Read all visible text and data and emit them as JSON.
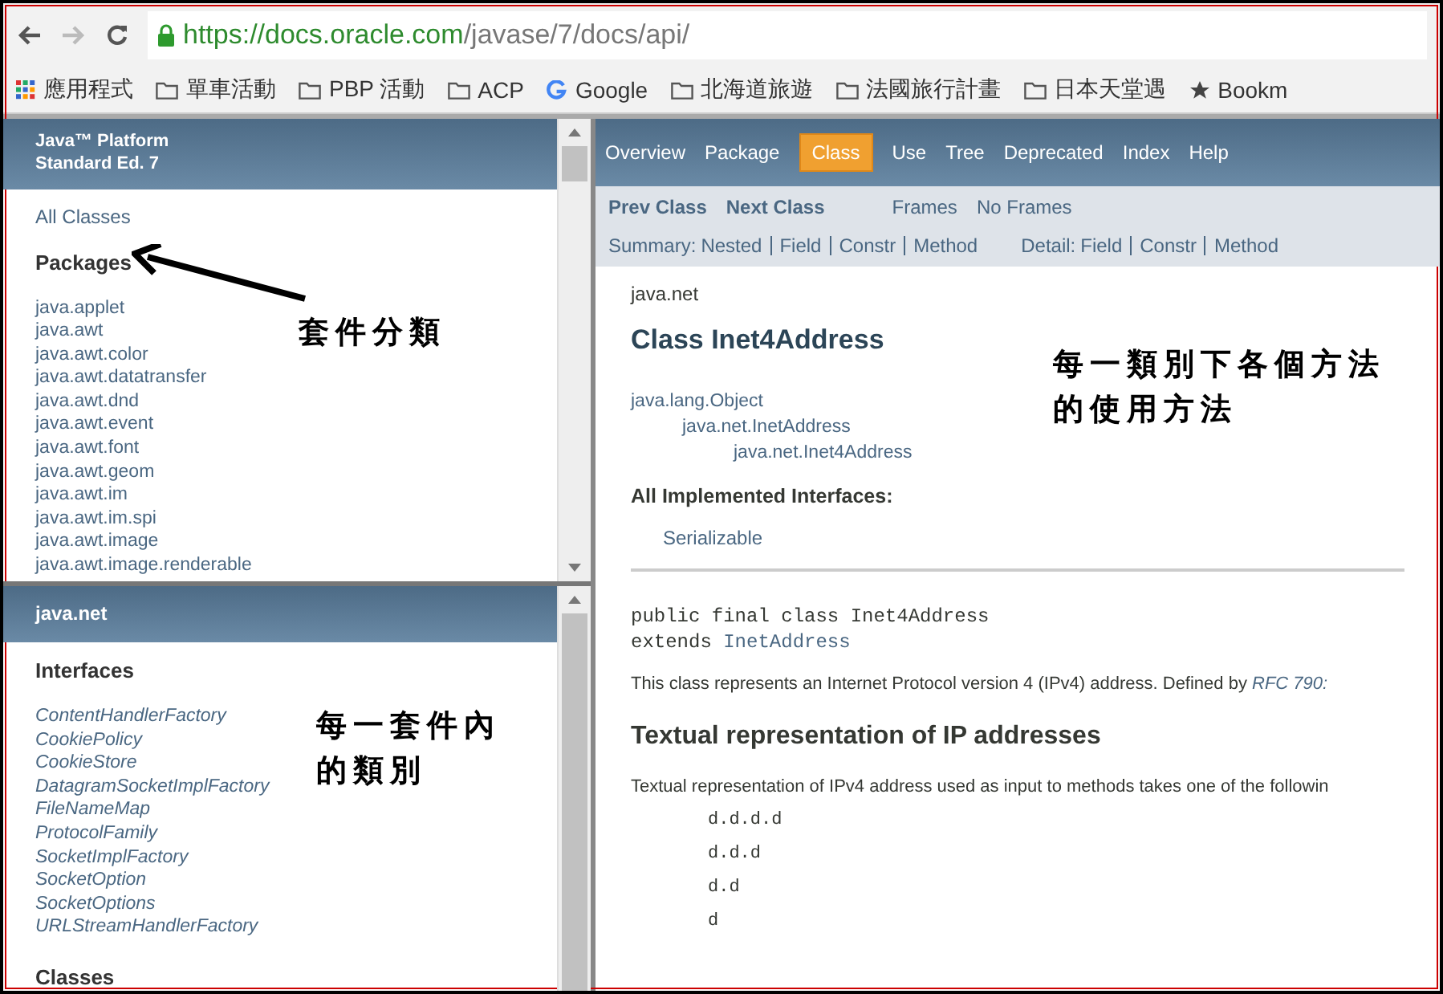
{
  "browser": {
    "url_host": "https://docs.oracle.com",
    "url_path": "/javase/7/docs/api/",
    "bookmarks": [
      {
        "kind": "apps",
        "label": "應用程式"
      },
      {
        "kind": "folder",
        "label": "單車活動"
      },
      {
        "kind": "folder",
        "label": "PBP 活動"
      },
      {
        "kind": "folder",
        "label": "ACP"
      },
      {
        "kind": "google",
        "label": "Google"
      },
      {
        "kind": "folder",
        "label": "北海道旅遊"
      },
      {
        "kind": "folder",
        "label": "法國旅行計畫"
      },
      {
        "kind": "folder",
        "label": "日本天堂遇"
      },
      {
        "kind": "star",
        "label": "Bookm"
      }
    ]
  },
  "packages_frame": {
    "title_lines": [
      "Java™ Platform",
      "Standard Ed. 7"
    ],
    "all_classes": "All Classes",
    "heading": "Packages",
    "packages": [
      "java.applet",
      "java.awt",
      "java.awt.color",
      "java.awt.datatransfer",
      "java.awt.dnd",
      "java.awt.event",
      "java.awt.font",
      "java.awt.geom",
      "java.awt.im",
      "java.awt.im.spi",
      "java.awt.image",
      "java.awt.image.renderable"
    ]
  },
  "package_frame": {
    "title": "java.net",
    "interfaces_heading": "Interfaces",
    "interfaces": [
      "ContentHandlerFactory",
      "CookiePolicy",
      "CookieStore",
      "DatagramSocketImplFactory",
      "FileNameMap",
      "ProtocolFamily",
      "SocketImplFactory",
      "SocketOption",
      "SocketOptions",
      "URLStreamHandlerFactory"
    ],
    "classes_heading": "Classes"
  },
  "class_frame": {
    "nav_tabs": [
      {
        "label": "Overview",
        "selected": false
      },
      {
        "label": "Package",
        "selected": false
      },
      {
        "label": "Class",
        "selected": true
      },
      {
        "label": "Use",
        "selected": false
      },
      {
        "label": "Tree",
        "selected": false
      },
      {
        "label": "Deprecated",
        "selected": false
      },
      {
        "label": "Index",
        "selected": false
      },
      {
        "label": "Help",
        "selected": false
      }
    ],
    "prev_class": "Prev Class",
    "next_class": "Next Class",
    "frames": "Frames",
    "no_frames": "No Frames",
    "summary_label": "Summary:",
    "summary_links": [
      "Nested",
      "Field",
      "Constr",
      "Method"
    ],
    "detail_label": "Detail:",
    "detail_links": [
      "Field",
      "Constr",
      "Method"
    ],
    "package_name": "java.net",
    "class_title": "Class Inet4Address",
    "hierarchy": [
      "java.lang.Object",
      "java.net.InetAddress",
      "java.net.Inet4Address"
    ],
    "interfaces_heading": "All Implemented Interfaces:",
    "interfaces": "Serializable",
    "declaration": "public final class Inet4Address",
    "extends_keyword": "extends",
    "extends_link": "InetAddress",
    "description": "This class represents an Internet Protocol version 4 (IPv4) address. Defined by",
    "description_link": "RFC 790:",
    "section_heading": "Textual representation of IP addresses",
    "section_text": "Textual representation of IPv4 address used as input to methods takes one of the followin",
    "formats": [
      "d.d.d.d",
      "d.d.d",
      "d.d",
      "d"
    ]
  },
  "annotations": [
    {
      "lines": [
        "套件分類"
      ]
    },
    {
      "lines": [
        "每一套件內",
        "的類別"
      ]
    },
    {
      "lines": [
        "每一類別下各個方法",
        "的使用方法"
      ]
    }
  ]
}
